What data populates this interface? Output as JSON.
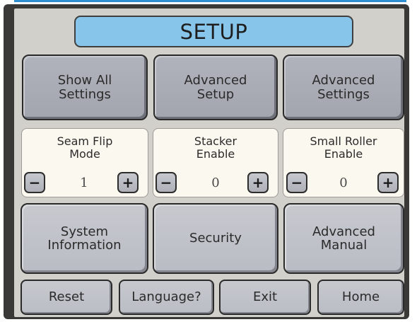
{
  "title": "SETUP",
  "top_buttons": [
    {
      "label": "Show All\nSettings"
    },
    {
      "label": "Advanced\nSetup"
    },
    {
      "label": "Advanced\nSettings"
    }
  ],
  "steppers": [
    {
      "label": "Seam Flip\nMode",
      "value": "1",
      "minus": "−",
      "plus": "+"
    },
    {
      "label": "Stacker\nEnable",
      "value": "0",
      "minus": "−",
      "plus": "+"
    },
    {
      "label": "Small Roller\nEnable",
      "value": "0",
      "minus": "−",
      "plus": "+"
    }
  ],
  "middle_buttons": [
    {
      "label": "System\nInformation"
    },
    {
      "label": "Security"
    },
    {
      "label": "Advanced\nManual"
    }
  ],
  "bottom_buttons": [
    {
      "label": "Reset"
    },
    {
      "label": "Language?"
    },
    {
      "label": "Exit"
    },
    {
      "label": "Home"
    }
  ],
  "colors": {
    "title_bg": "#87c5ea",
    "screen_bg": "#d1d0cb",
    "panel_bg": "#fbf8ef",
    "button_dark": "#a2a5ae",
    "button_light": "#b9bcc3"
  }
}
